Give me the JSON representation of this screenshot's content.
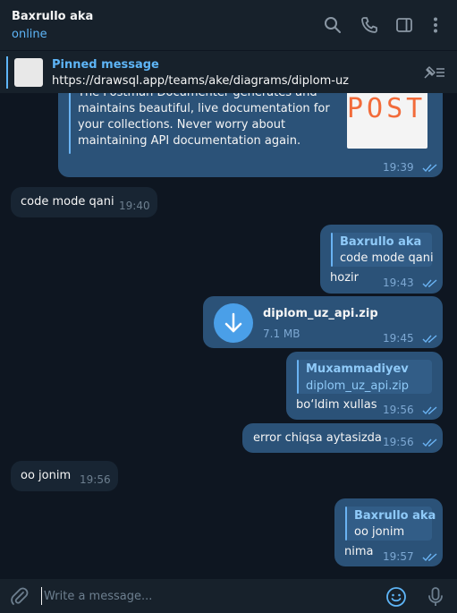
{
  "header": {
    "chat_name": "Baxrullo aka",
    "status": "online"
  },
  "pinned": {
    "title": "Pinned message",
    "text": "https://drawsql.app/teams/ake/diagrams/diplom-uz"
  },
  "messages": {
    "preview": {
      "text": "The Postman Documenter generates and maintains beautiful, live documentation for your collections. Never worry about maintaining API documentation again.",
      "image_word": "POST",
      "time": "19:39"
    },
    "m1": {
      "text": "code mode qani",
      "time": "19:40"
    },
    "m2": {
      "reply_name": "Baxrullo aka",
      "reply_text": "code mode qani",
      "text": "hozir",
      "time": "19:43"
    },
    "m3": {
      "file_name": "diplom_uz_api.zip",
      "file_size": "7.1 MB",
      "time": "19:45"
    },
    "m4": {
      "reply_name": "Muxammadiyev",
      "reply_text": "diplom_uz_api.zip",
      "text": "bo‘ldim xullas",
      "time": "19:56"
    },
    "m5": {
      "text": "error chiqsa aytasizda",
      "time": "19:56"
    },
    "m6": {
      "text": "oo jonim",
      "time": "19:56"
    },
    "m7": {
      "reply_name": "Baxrullo aka",
      "reply_text": "oo jonim",
      "text": "nima",
      "time": "19:57"
    }
  },
  "composer": {
    "placeholder": "Write a message..."
  },
  "icons": {
    "search": "search-icon",
    "call": "phone-icon",
    "sidebar": "sidebar-toggle-icon",
    "more": "more-vertical-icon",
    "unpin": "unpin-icon",
    "attach": "paperclip-icon",
    "emoji": "emoji-icon",
    "voice": "microphone-icon",
    "download": "download-icon"
  },
  "colors": {
    "background": "#0e1621",
    "panel": "#17212b",
    "bubble_out": "#2b5278",
    "bubble_in": "#182533",
    "accent": "#5eb5f7"
  }
}
